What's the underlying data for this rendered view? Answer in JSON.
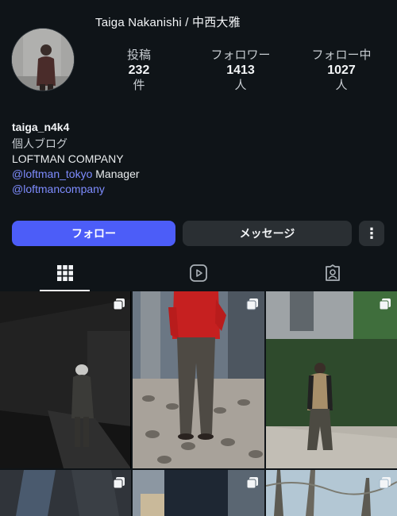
{
  "profile": {
    "display_name": "Taiga Nakanishi / 中西大雅",
    "username": "taiga_n4k4",
    "category": "個人ブログ",
    "bio_line1": "LOFTMAN COMPANY",
    "bio_mention1": "@loftman_tokyo",
    "bio_mention1_suffix": " Manager",
    "bio_mention2": "@loftmancompany"
  },
  "stats": [
    {
      "label": "投稿",
      "value": "232",
      "unit": "件"
    },
    {
      "label": "フォロワー",
      "value": "1413",
      "unit": "人"
    },
    {
      "label": "フォロー中",
      "value": "1027",
      "unit": "人"
    }
  ],
  "actions": {
    "follow": "フォロー",
    "message": "メッセージ",
    "more": "⋮"
  },
  "tabs": [
    {
      "icon": "grid-icon",
      "active": true
    },
    {
      "icon": "reels-icon",
      "active": false
    },
    {
      "icon": "tagged-icon",
      "active": false
    }
  ],
  "colors": {
    "background": "#0f1418",
    "accent": "#4c5df8",
    "link": "#7e8cff",
    "button_secondary": "#2a2f33"
  }
}
